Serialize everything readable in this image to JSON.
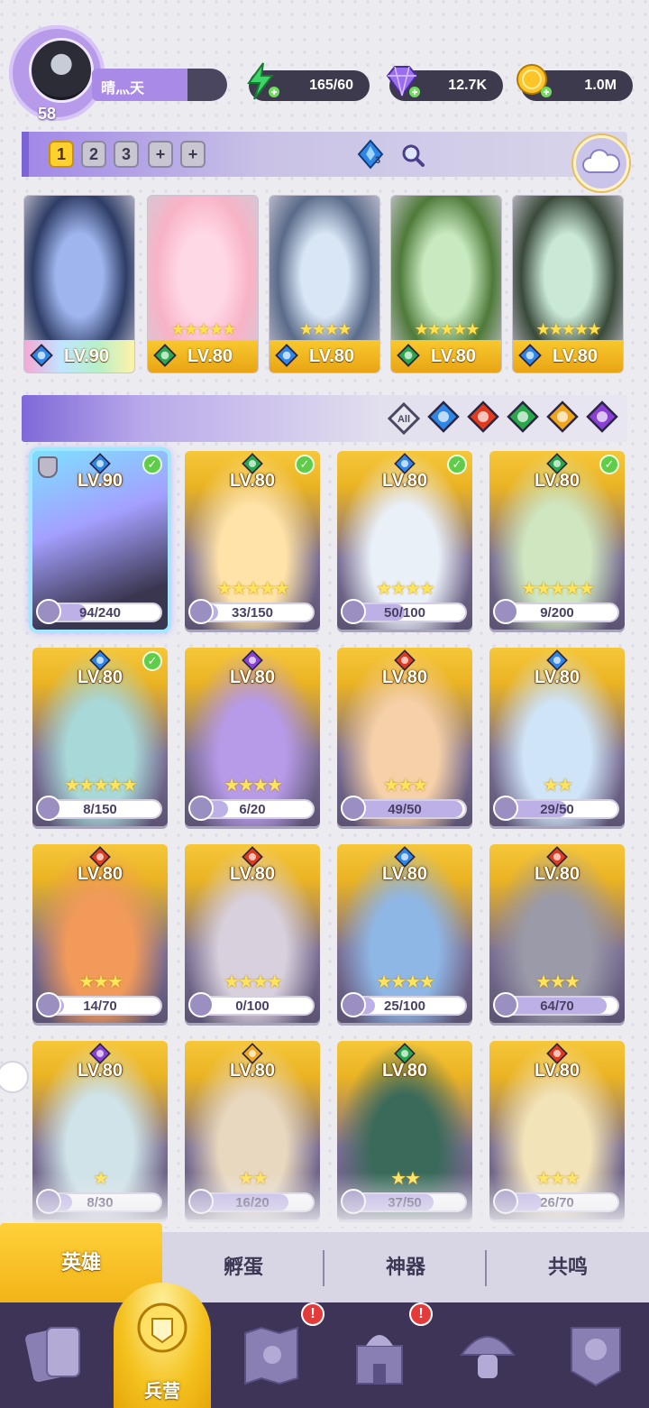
{
  "player": {
    "level": "58",
    "name": "晴灬天"
  },
  "resources": {
    "energy": "165/60",
    "gems": "12.7K",
    "gold": "1.0M"
  },
  "team": {
    "tabs": [
      "1",
      "2",
      "3",
      "+",
      "+"
    ],
    "active_tab": "1",
    "gem_count": "3",
    "cards": [
      {
        "level": "LV.90",
        "stars": "",
        "element": "water"
      },
      {
        "level": "LV.80",
        "stars": "★★★★★",
        "element": "nature"
      },
      {
        "level": "LV.80",
        "stars": "★★★★",
        "element": "water"
      },
      {
        "level": "LV.80",
        "stars": "★★★★★",
        "element": "nature"
      },
      {
        "level": "LV.80",
        "stars": "★★★★★",
        "element": "water"
      }
    ]
  },
  "filters": {
    "all_label": "All",
    "elements": [
      "water",
      "fire",
      "nature",
      "light",
      "dark"
    ]
  },
  "heroes": [
    {
      "level": "LV.90",
      "element": "water",
      "shard": "94/240",
      "progress": 0.39,
      "stars": "",
      "deployed": true
    },
    {
      "level": "LV.80",
      "element": "nature",
      "shard": "33/150",
      "progress": 0.22,
      "stars": "★★★★★",
      "deployed": true
    },
    {
      "level": "LV.80",
      "element": "water",
      "shard": "50/100",
      "progress": 0.5,
      "stars": "★★★★",
      "deployed": true
    },
    {
      "level": "LV.80",
      "element": "nature",
      "shard": "9/200",
      "progress": 0.05,
      "stars": "★★★★★",
      "deployed": true
    },
    {
      "level": "LV.80",
      "element": "water",
      "shard": "8/150",
      "progress": 0.05,
      "stars": "★★★★★",
      "deployed": true
    },
    {
      "level": "LV.80",
      "element": "dark",
      "shard": "6/20",
      "progress": 0.3,
      "stars": "★★★★",
      "deployed": false
    },
    {
      "level": "LV.80",
      "element": "fire",
      "shard": "49/50",
      "progress": 0.98,
      "stars": "★★★",
      "deployed": false
    },
    {
      "level": "LV.80",
      "element": "water",
      "shard": "29/50",
      "progress": 0.58,
      "stars": "★★",
      "deployed": false
    },
    {
      "level": "LV.80",
      "element": "fire",
      "shard": "14/70",
      "progress": 0.2,
      "stars": "★★★",
      "deployed": false
    },
    {
      "level": "LV.80",
      "element": "fire",
      "shard": "0/100",
      "progress": 0.0,
      "stars": "★★★★",
      "deployed": false
    },
    {
      "level": "LV.80",
      "element": "water",
      "shard": "25/100",
      "progress": 0.25,
      "stars": "★★★★",
      "deployed": false
    },
    {
      "level": "LV.80",
      "element": "fire",
      "shard": "64/70",
      "progress": 0.91,
      "stars": "★★★",
      "deployed": false
    },
    {
      "level": "LV.80",
      "element": "dark",
      "shard": "8/30",
      "progress": 0.27,
      "stars": "★",
      "deployed": false
    },
    {
      "level": "LV.80",
      "element": "light",
      "shard": "16/20",
      "progress": 0.8,
      "stars": "★★",
      "deployed": false
    },
    {
      "level": "LV.80",
      "element": "nature",
      "shard": "37/50",
      "progress": 0.74,
      "stars": "★★",
      "deployed": false
    },
    {
      "level": "LV.80",
      "element": "fire",
      "shard": "26/70",
      "progress": 0.37,
      "stars": "★★★",
      "deployed": false
    }
  ],
  "subtabs": [
    "英雄",
    "孵蛋",
    "神器",
    "共鸣"
  ],
  "active_subtab": "英雄",
  "bottom_nav": {
    "active_label": "兵营",
    "items": [
      {
        "icon": "cards-icon",
        "alert": false
      },
      {
        "icon": "barracks-icon",
        "alert": false
      },
      {
        "icon": "map-icon",
        "alert": true
      },
      {
        "icon": "castle-icon",
        "alert": true
      },
      {
        "icon": "mushroom-icon",
        "alert": false
      },
      {
        "icon": "guild-banner-icon",
        "alert": false
      }
    ],
    "alert_symbol": "!"
  },
  "colors": {
    "water": "#2d86e8",
    "fire": "#e23a1c",
    "nature": "#28a84a",
    "light": "#f0a61a",
    "dark": "#8a3fd6",
    "accent_purple": "#a98ae6",
    "accent_yellow": "#ffd02e"
  }
}
